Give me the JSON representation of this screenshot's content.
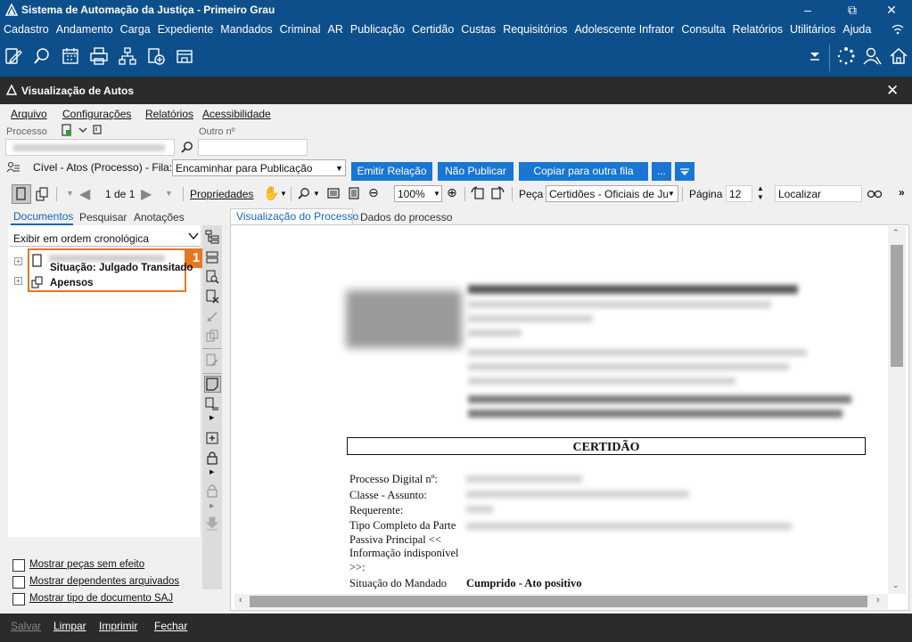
{
  "app": {
    "title": "Sistema de Automação da Justiça - Primeiro Grau"
  },
  "menu": [
    "Cadastro",
    "Andamento",
    "Carga",
    "Expediente",
    "Mandados",
    "Criminal",
    "AR",
    "Publicação",
    "Certidão",
    "Custas",
    "Requisitórios",
    "Adolescente Infrator",
    "Consulta",
    "Relatórios",
    "Utilitários",
    "Ajuda"
  ],
  "window": {
    "title": "Visualização de Autos"
  },
  "submenu": {
    "arquivo": "Arquivo",
    "configuracoes": "Configurações",
    "relatorios": "Relatórios",
    "acessibilidade": "Acessibilidade"
  },
  "fields": {
    "processo_label": "Processo",
    "outro_label": "Outro nº"
  },
  "fila": {
    "label": "Cível - Atos (Processo) - Fila:",
    "value": "Encaminhar para Publicação"
  },
  "actions": {
    "emitir": "Emitir Relação",
    "nao_publicar": "Não Publicar",
    "copiar": "Copiar para outra fila",
    "more": "..."
  },
  "toolbar": {
    "page_count": "1 de 1",
    "propriedades": "Propriedades",
    "zoom": "100%",
    "peca_label": "Peça",
    "peca_value": "Certidões - Oficiais de Jus",
    "pagina_label": "Página",
    "pagina_value": "12",
    "localizar": "Localizar"
  },
  "left_tabs": {
    "documentos": "Documentos",
    "pesquisar": "Pesquisar",
    "anotacoes": "Anotações"
  },
  "order_select": "Exibir em ordem cronológica",
  "tree": {
    "situacao": "Situação: Julgado Transitado",
    "apensos": "Apensos",
    "badge": "1"
  },
  "checkboxes": {
    "sem_efeito": "Mostrar peças sem efeito",
    "dependentes": "Mostrar dependentes arquivados",
    "tipo": "Mostrar tipo de documento SAJ"
  },
  "view_tabs": {
    "visualizacao": "Visualização do Processo",
    "dados": "Dados do processo"
  },
  "document": {
    "heading": "CERTIDÃO",
    "rows": [
      {
        "label": "Processo Digital nº:"
      },
      {
        "label": "Classe - Assunto:"
      },
      {
        "label": "Requerente:"
      },
      {
        "label": "Tipo Completo da Parte Passiva Principal << Informação indisponível >>:"
      },
      {
        "label": "Situação do Mandado",
        "value": "Cumprido - Ato positivo"
      }
    ]
  },
  "footer": {
    "salvar": "Salvar",
    "limpar": "Limpar",
    "imprimir": "Imprimir",
    "fechar": "Fechar"
  },
  "colors": {
    "title_bg": "#0d4f8b",
    "window_bar": "#2b2b2b",
    "accent": "#1976d2",
    "badge": "#e87722"
  }
}
